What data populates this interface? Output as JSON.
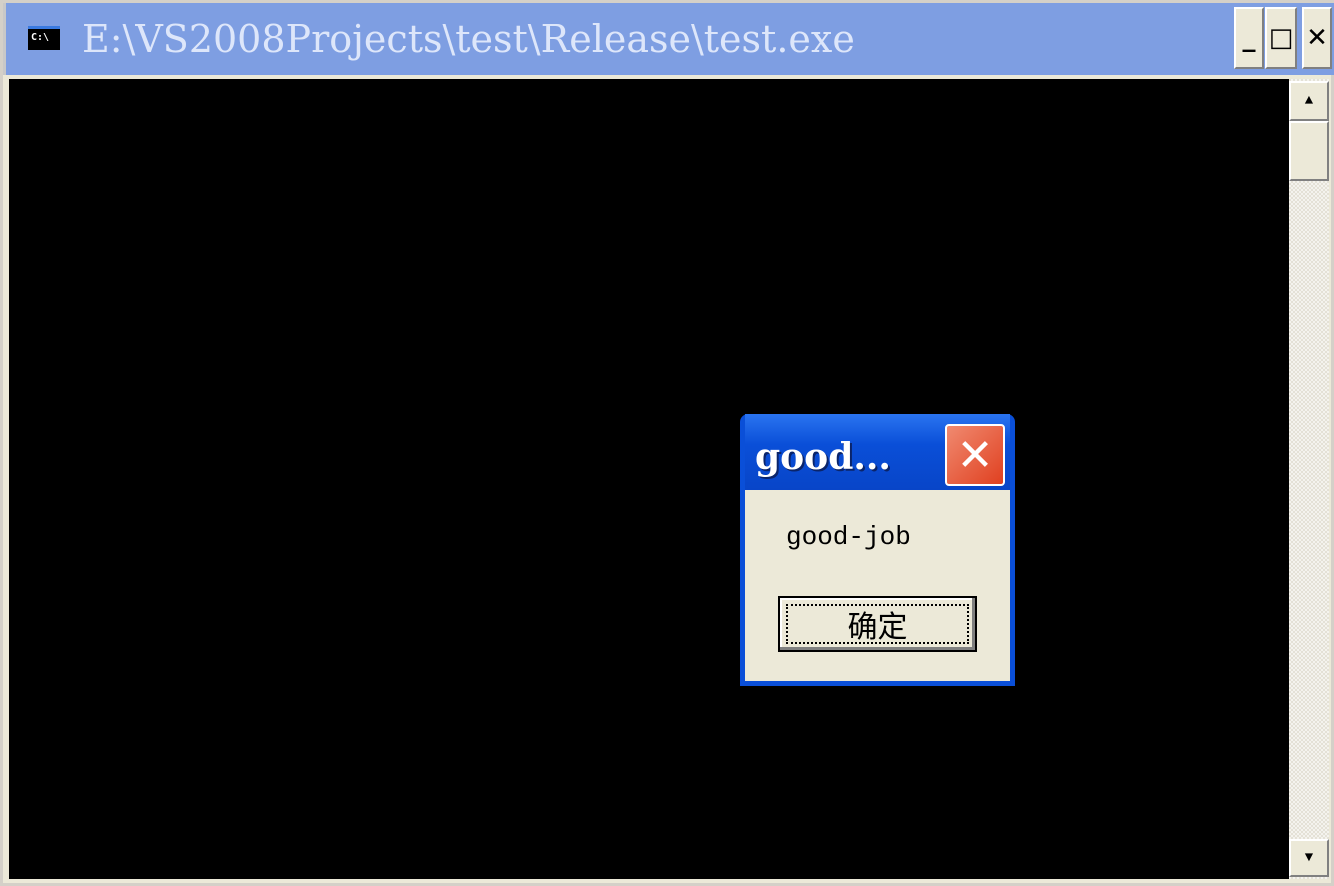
{
  "window": {
    "title": "E:\\VS2008Projects\\test\\Release\\test.exe",
    "icon_text": "C:\\",
    "minimize": "_",
    "maximize": "□",
    "close": "✕"
  },
  "scrollbar": {
    "up": "▲",
    "down": "▼"
  },
  "dialog": {
    "title": "good...",
    "close": "✕",
    "message": "good-job",
    "ok_label": "确定"
  }
}
